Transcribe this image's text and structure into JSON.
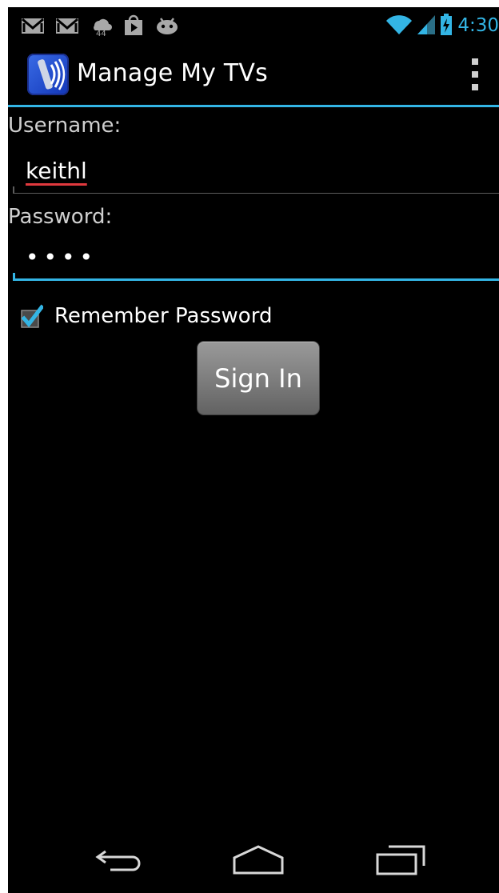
{
  "status_bar": {
    "time": "4:30",
    "accent_color": "#33b5e5",
    "left_icons": [
      "gmail-icon",
      "gmail-icon",
      "weather-icon",
      "play-store-icon",
      "android-icon"
    ],
    "right_icons": [
      "wifi-icon",
      "signal-icon",
      "battery-charging-icon"
    ]
  },
  "action_bar": {
    "title": "Manage My TVs",
    "app_icon": "remote-app-icon",
    "overflow_icon": "overflow-menu-icon"
  },
  "form": {
    "username_label": "Username:",
    "username_value": "keithl",
    "password_label": "Password:",
    "password_value": "••••",
    "remember_label": "Remember Password",
    "remember_checked": true,
    "sign_in_label": "Sign In"
  },
  "nav_bar": {
    "icons": [
      "back-icon",
      "home-icon",
      "recents-icon"
    ]
  }
}
